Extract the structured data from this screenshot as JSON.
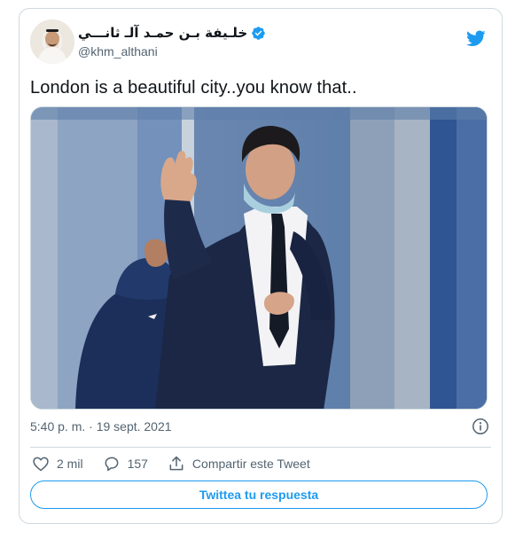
{
  "account": {
    "display_name": "خلـيفة بـن حمـد آلـ ثانـــي",
    "handle": "@khm_althani",
    "verified": true
  },
  "tweet": {
    "text": "London is a beautiful city..you know that..",
    "timestamp": "5:40 p. m. · 19 sept. 2021"
  },
  "actions": {
    "likes": "2 mil",
    "replies": "157",
    "share_label": "Compartir este Tweet"
  },
  "reply_button": {
    "label": "Twittea tu respuesta"
  },
  "icons": {
    "brand": "twitter-bird-icon",
    "verified": "verified-badge-icon",
    "info": "info-icon",
    "like": "heart-icon",
    "reply": "speech-bubble-icon",
    "share": "share-icon"
  },
  "colors": {
    "accent": "#1d9bf0",
    "secondary_text": "#536471",
    "border": "#cfd9de"
  }
}
